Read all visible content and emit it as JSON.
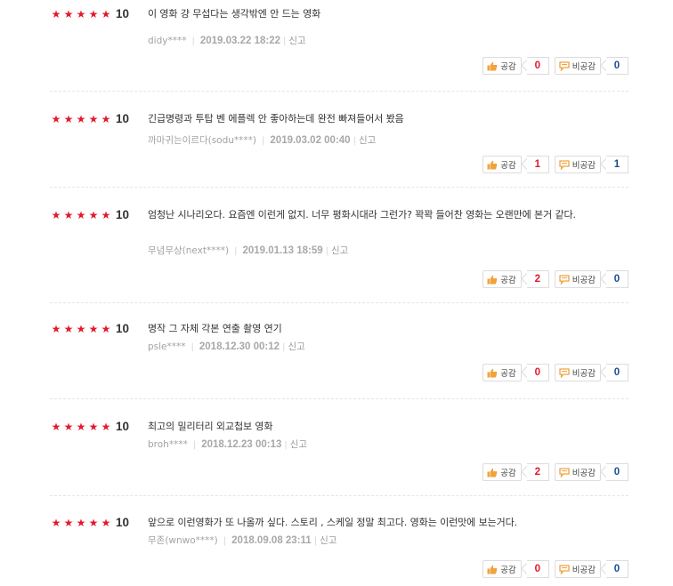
{
  "labels": {
    "like": "공감",
    "dislike": "비공감",
    "report": "신고"
  },
  "colors": {
    "star": "#e2192d",
    "like_count": "#e2192d",
    "dislike_count": "#1c4c8f"
  },
  "reviews": [
    {
      "stars": "★★★★★",
      "score": "10",
      "text": "이 영화 걍 무섭다는 생각밖엔 안 드는 영화",
      "author": "didy****",
      "date": "2019.03.22 18:22",
      "likes": "0",
      "dislikes": "0"
    },
    {
      "stars": "★★★★★",
      "score": "10",
      "text": "긴급명령과 투탑 벤 에플렉 안 좋아하는데 완전 빠져들어서 봤음",
      "author": "까마귀는이르다(sodu****)",
      "date": "2019.03.02 00:40",
      "likes": "1",
      "dislikes": "1"
    },
    {
      "stars": "★★★★★",
      "score": "10",
      "text": "엄청난 시나리오다. 요즘엔 이런게 없지. 너무 평화시대라 그런가? 꽉꽉 들어찬 영화는 오랜만에 본거 같다.",
      "author": "무념무상(next****)",
      "date": "2019.01.13 18:59",
      "likes": "2",
      "dislikes": "0"
    },
    {
      "stars": "★★★★★",
      "score": "10",
      "text": "명작 그 자체 각본 연출 촬영 연기",
      "author": "psle****",
      "date": "2018.12.30 00:12",
      "likes": "0",
      "dislikes": "0"
    },
    {
      "stars": "★★★★★",
      "score": "10",
      "text": "최고의 밀리터리 외교첩보 영화",
      "author": "broh****",
      "date": "2018.12.23 00:13",
      "likes": "2",
      "dislikes": "0"
    },
    {
      "stars": "★★★★★",
      "score": "10",
      "text": "앞으로 이런영화가 또 나올까 싶다. 스토리 , 스케일 정말 최고다. 영화는 이런맛에 보는거다.",
      "author": "무존(wnwo****)",
      "date": "2018.09.08 23:11",
      "likes": "0",
      "dislikes": "0"
    }
  ]
}
